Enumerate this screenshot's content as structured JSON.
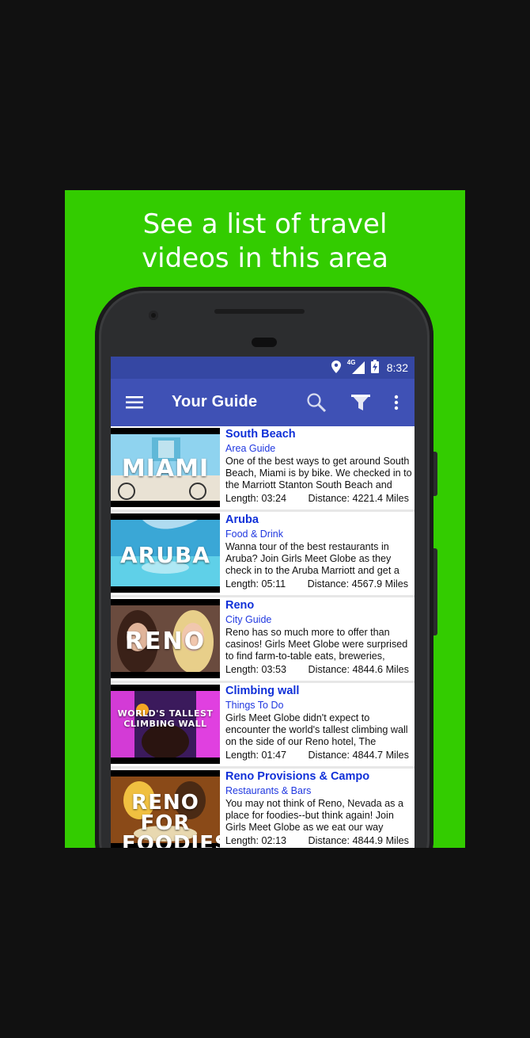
{
  "caption": {
    "line1": "See a list of travel",
    "line2": "videos in this area"
  },
  "status_bar": {
    "time": "8:32",
    "network": "4G",
    "icons": [
      "location-icon",
      "signal-icon",
      "battery-icon"
    ]
  },
  "app_bar": {
    "title": "Your Guide",
    "icons": [
      "menu-icon",
      "search-icon",
      "filter-icon",
      "more-vert-icon"
    ]
  },
  "colors": {
    "promo_bg": "#33cc00",
    "app_bar": "#3f51b5",
    "status_bar": "#3547a3",
    "link": "#1030d8"
  },
  "length_label": "Length:",
  "distance_label": "Distance:",
  "items": [
    {
      "title": "South Beach",
      "category": "Area Guide",
      "description": "One of the best ways to get around South Beach, Miami is by bike. We checked in to the Marriott Stanton South Beach and",
      "length": "03:24",
      "distance": "4221.4 Miles",
      "thumb_text": "MIAMI"
    },
    {
      "title": "Aruba",
      "category": "Food & Drink",
      "description": "Wanna tour of the best restaurants in Aruba? Join Girls Meet Globe as they check in to the Aruba Marriott and get a",
      "length": "05:11",
      "distance": "4567.9 Miles",
      "thumb_text": "ARUBA"
    },
    {
      "title": "Reno",
      "category": "City Guide",
      "description": "Reno has so much more to offer than casinos! Girls Meet Globe were surprised to find farm-to-table eats, breweries,",
      "length": "03:53",
      "distance": "4844.6 Miles",
      "thumb_text": "RENO"
    },
    {
      "title": "Climbing wall",
      "category": "Things To Do",
      "description": "Girls Meet Globe didn't expect to encounter the world's tallest climbing wall on the side of our Reno hotel, The",
      "length": "01:47",
      "distance": "4844.7 Miles",
      "thumb_text": "WORLD'S TALLEST CLIMBING WALL"
    },
    {
      "title": "Reno Provisions & Campo",
      "category": "Restaurants & Bars",
      "description": "You may not think of Reno, Nevada as a place for foodies--but think again! Join Girls Meet Globe as we eat our way",
      "length": "02:13",
      "distance": "4844.9 Miles",
      "thumb_text": "RENO FOR FOODIES"
    }
  ]
}
